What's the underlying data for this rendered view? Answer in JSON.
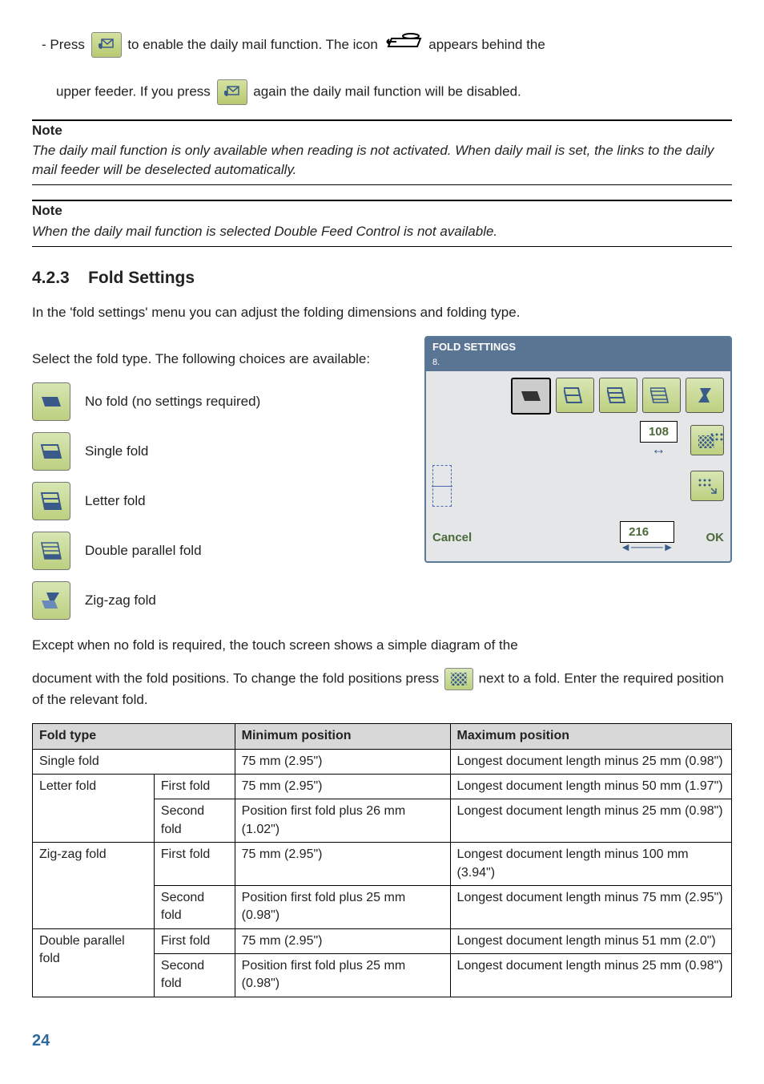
{
  "bullet": {
    "line1_a": "Press ",
    "line1_b": " to enable the daily mail function. The icon ",
    "line1_c": " appears behind the",
    "line2_a": "upper feeder. If you press ",
    "line2_b": " again the daily mail function will be disabled."
  },
  "note1": {
    "label": "Note",
    "body": "The daily mail function is only available when reading is not activated. When daily mail is set, the links to the daily mail feeder will be deselected automatically."
  },
  "note2": {
    "label": "Note",
    "body": "When the daily mail function is selected Double Feed Control is not available."
  },
  "section": {
    "number": "4.2.3",
    "title": "Fold Settings",
    "intro": "In the 'fold settings' menu you can adjust the folding dimensions and folding type.",
    "select": "Select the fold type. The following choices are available:"
  },
  "folds": {
    "none": "No fold (no settings required)",
    "single": "Single fold",
    "letter": "Letter fold",
    "double": "Double parallel fold",
    "zigzag": "Zig-zag fold"
  },
  "screen": {
    "title": "FOLD SETTINGS",
    "page": "8.",
    "dim1": "108",
    "dim2": "216",
    "cancel": "Cancel",
    "ok": "OK"
  },
  "para1": "Except when no fold is required, the touch screen shows a simple diagram of the",
  "para2_a": "document with the fold positions. To change the fold positions press ",
  "para2_b": " next to a fold. Enter the required position of the relevant fold.",
  "table": {
    "h1": "Fold type",
    "h2": "Minimum position",
    "h3": "Maximum position",
    "rows": [
      {
        "c1": "Single fold",
        "c2": "",
        "c3": "75 mm (2.95\")",
        "c4": "Longest document length minus 25 mm (0.98\")"
      },
      {
        "c1": "Letter fold",
        "c2": "First fold",
        "c3": "75 mm (2.95\")",
        "c4": "Longest document length minus 50 mm (1.97\")"
      },
      {
        "c1": "",
        "c2": "Second fold",
        "c3": "Position first fold plus 26 mm (1.02\")",
        "c4": "Longest document length minus 25 mm (0.98\")"
      },
      {
        "c1": "Zig-zag fold",
        "c2": "First fold",
        "c3": "75 mm (2.95\")",
        "c4": "Longest document length minus 100 mm (3.94\")"
      },
      {
        "c1": "",
        "c2": "Second fold",
        "c3": "Position first fold plus 25 mm (0.98\")",
        "c4": "Longest document length minus 75 mm (2.95\")"
      },
      {
        "c1": "Double parallel fold",
        "c2": "First fold",
        "c3": "75 mm (2.95\")",
        "c4": "Longest document length minus 51 mm (2.0\")"
      },
      {
        "c1": "",
        "c2": "Second fold",
        "c3": "Position first fold plus 25 mm (0.98\")",
        "c4": "Longest document length minus 25 mm (0.98\")"
      }
    ]
  },
  "pageNumber": "24"
}
